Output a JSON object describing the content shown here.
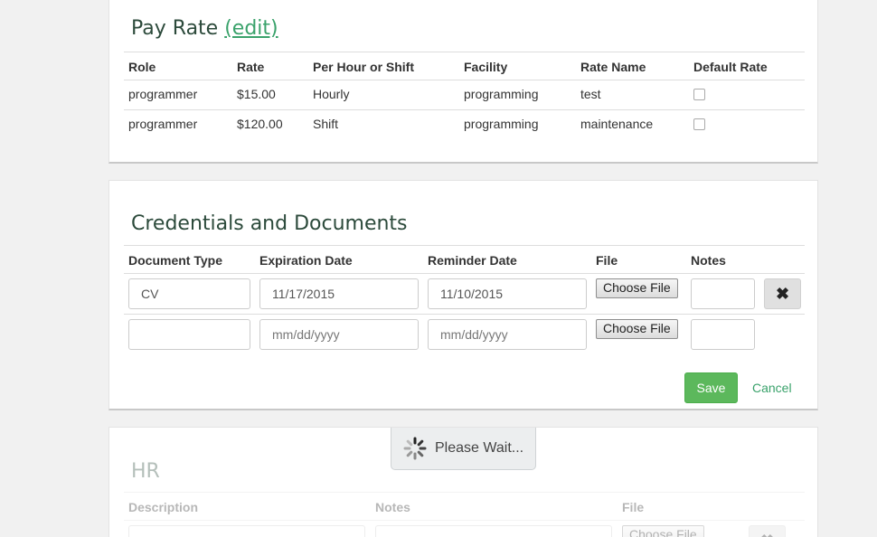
{
  "pay_rate": {
    "title": "Pay Rate",
    "edit_label": "(edit)",
    "columns": [
      "Role",
      "Rate",
      "Per Hour or Shift",
      "Facility",
      "Rate Name",
      "Default Rate"
    ],
    "rows": [
      {
        "role": "programmer",
        "rate": "$15.00",
        "per": "Hourly",
        "facility": "programming",
        "rate_name": "test",
        "default": false
      },
      {
        "role": "programmer",
        "rate": "$120.00",
        "per": "Shift",
        "facility": "programming",
        "rate_name": "maintenance",
        "default": false
      }
    ]
  },
  "credentials": {
    "title": "Credentials and Documents",
    "columns": [
      "Document Type",
      "Expiration Date",
      "Reminder Date",
      "File",
      "Notes"
    ],
    "rows": [
      {
        "document_type": "CV",
        "expiration_date": "11/17/2015",
        "reminder_date": "11/10/2015",
        "file_button": "Choose File",
        "notes": ""
      },
      {
        "document_type": "",
        "expiration_date": "",
        "reminder_date": "",
        "file_button": "Choose File",
        "notes": ""
      }
    ],
    "date_placeholder": "mm/dd/yyyy",
    "save_label": "Save",
    "cancel_label": "Cancel"
  },
  "hr": {
    "title": "HR",
    "columns": [
      "Description",
      "Notes",
      "File"
    ],
    "file_button": "Choose File"
  },
  "loading": {
    "text": "Please Wait..."
  },
  "colors": {
    "accent": "#3aa26b",
    "save": "#5cb85c",
    "title": "#2c4a3b"
  }
}
